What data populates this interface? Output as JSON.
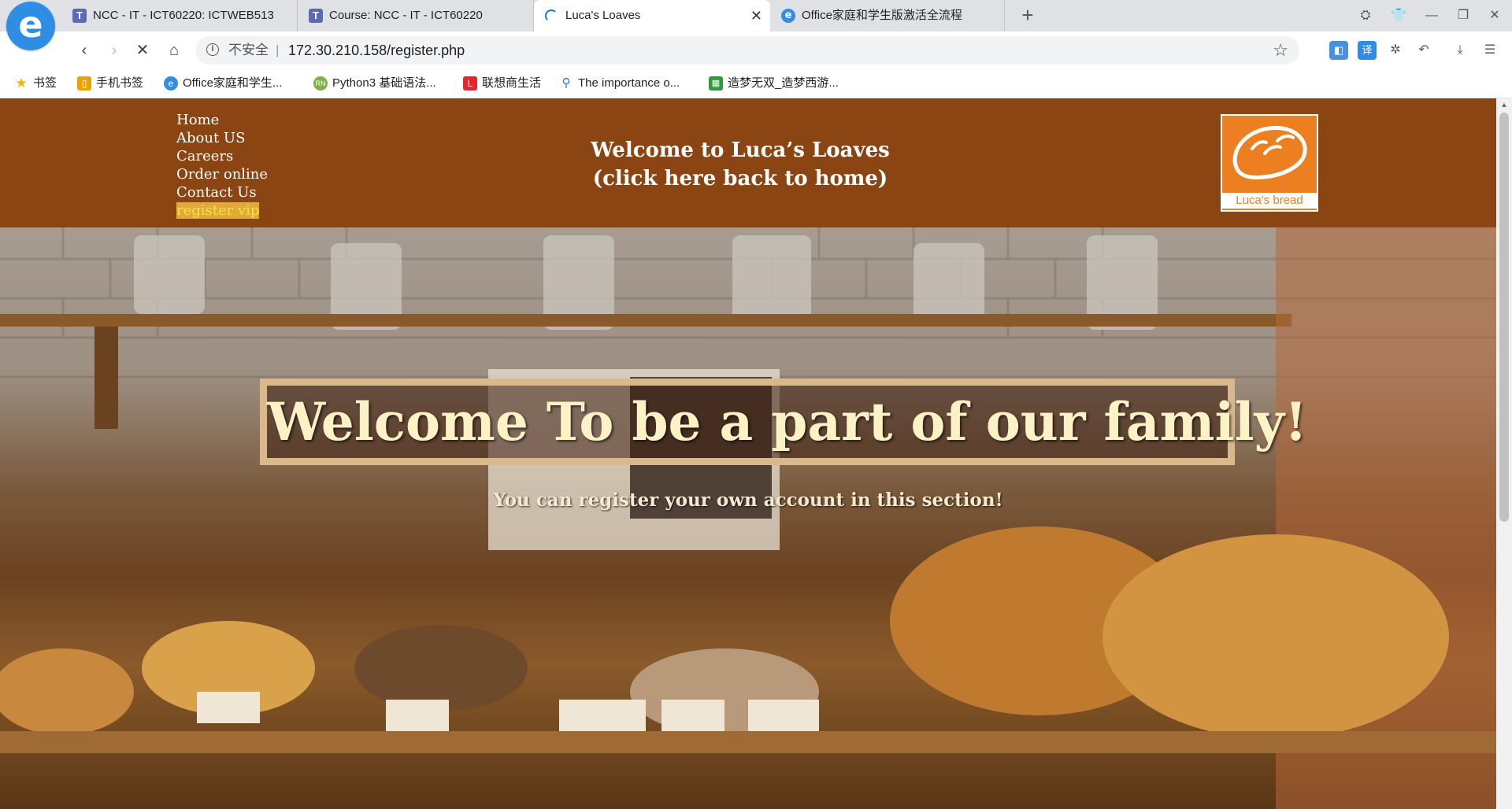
{
  "browser": {
    "tabs": [
      {
        "title": "NCC - IT - ICT60220: ICTWEB513",
        "icon": "teams-icon"
      },
      {
        "title": "Course: NCC - IT - ICT60220",
        "icon": "teams-icon"
      },
      {
        "title": "Luca's Loaves",
        "icon": "loading-spinner-icon",
        "active": true
      },
      {
        "title": "Office家庭和学生版激活全流程",
        "icon": "edge-icon"
      }
    ],
    "insecure_label": "不安全",
    "separator": "|",
    "url": "172.30.210.158/register.php",
    "bookmarks": [
      {
        "label": "书签",
        "icon": "star-icon",
        "color": "#f5b400"
      },
      {
        "label": "手机书签",
        "icon": "phone-icon",
        "color": "#e8a400"
      },
      {
        "label": "Office家庭和学生...",
        "icon": "edge-icon",
        "color": "#2f8de4"
      },
      {
        "label": "Python3 基础语法...",
        "icon": "runoob-icon",
        "color": "#7cb342"
      },
      {
        "label": "联想商生活",
        "icon": "lenovo-icon",
        "color": "#e3262c"
      },
      {
        "label": "The importance o...",
        "icon": "search-icon",
        "color": "#2f6fd6"
      },
      {
        "label": "造梦无双_造梦西游...",
        "icon": "game-icon",
        "color": "#2e9a3a"
      }
    ]
  },
  "site": {
    "nav": [
      "Home",
      "About US",
      "Careers",
      "Order online",
      "Contact Us",
      "register vip"
    ],
    "welcome_line1": "Welcome to Luca’s Loaves",
    "welcome_line2": "(click here back to home)",
    "logo_text": "Luca's bread",
    "hero_title": "Welcome To be a part of our family!",
    "hero_subtitle": "You can register your own account in this section!",
    "colors": {
      "header": "#8b4513",
      "logo_bg": "#ec7f20",
      "nav_highlight": "#e0a93a",
      "hero_title": "#fdf1c6"
    }
  }
}
